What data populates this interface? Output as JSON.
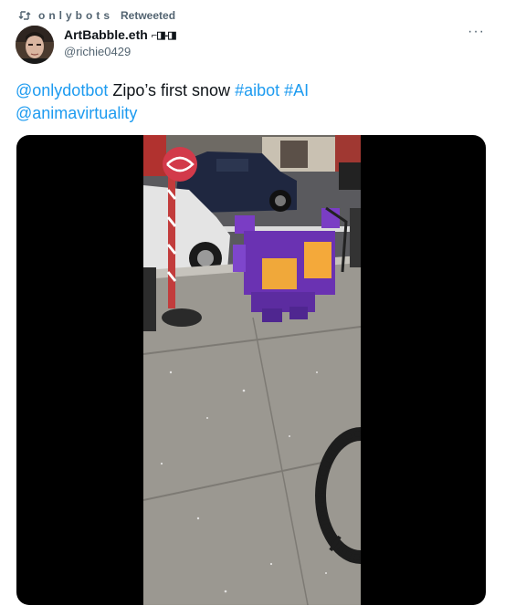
{
  "retweet": {
    "icon": "retweet-icon",
    "user": "onlybots",
    "label": "Retweeted"
  },
  "author": {
    "display_name": "ArtBabble.eth",
    "name_glyph": "⌐◨-◨",
    "handle": "@richie0429",
    "avatar": "profile-photo"
  },
  "more": "···",
  "text": {
    "mention1": "@onlydotbot",
    "body": " Zipo’s first snow ",
    "hashtag1": "#aibot",
    "space": " ",
    "hashtag2": "#AI",
    "mention2": "@animavirtuality"
  },
  "media": {
    "type": "video",
    "description_icon": "video-still"
  },
  "colors": {
    "link": "#1d9bf0",
    "secondary_text": "#536471",
    "primary_text": "#0f1419"
  }
}
